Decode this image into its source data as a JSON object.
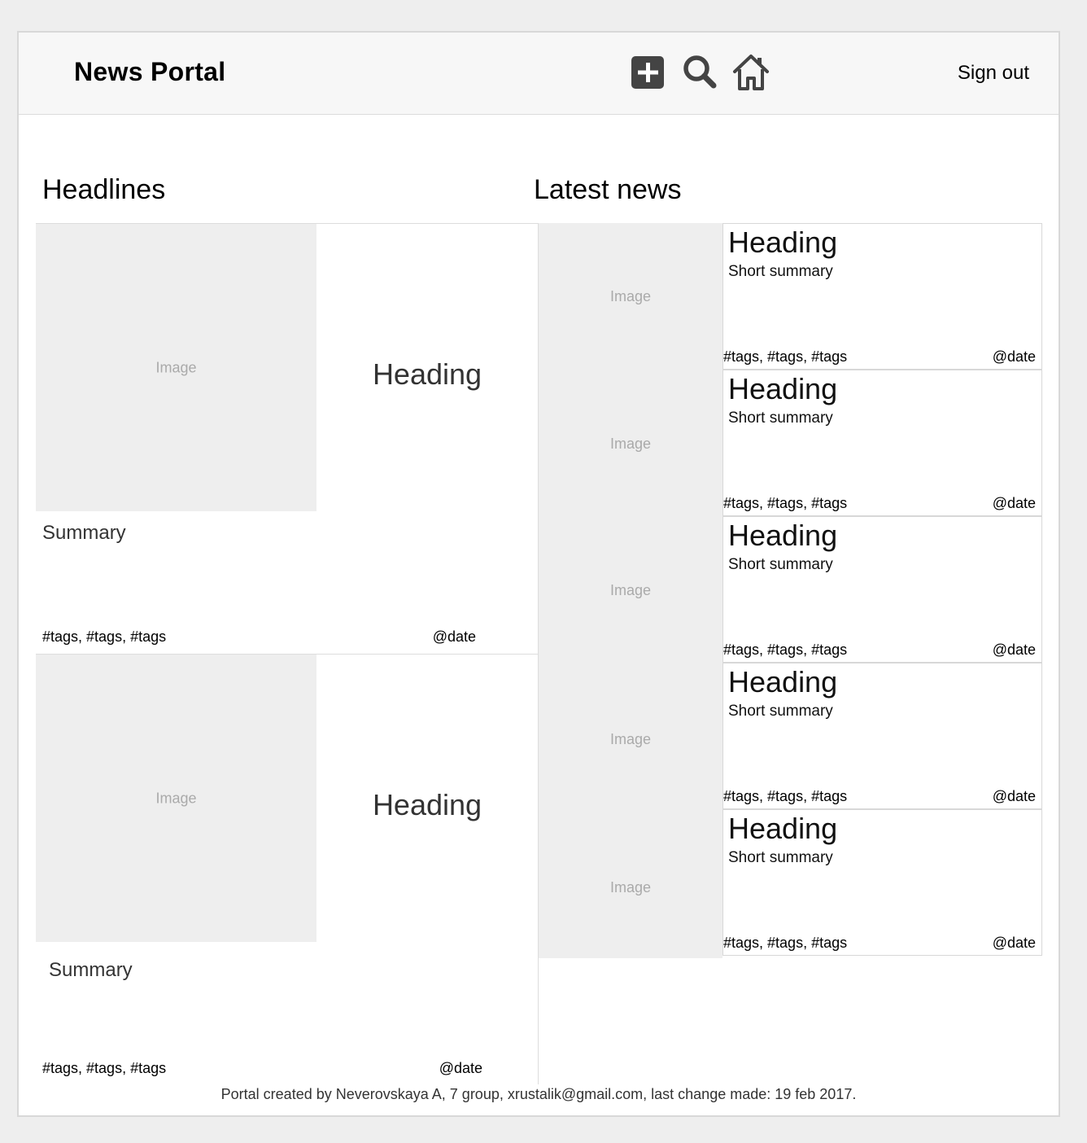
{
  "header": {
    "title": "News Portal",
    "sign_out_label": "Sign out",
    "icons": [
      "add-icon",
      "search-icon",
      "home-icon"
    ]
  },
  "sections": {
    "headlines_title": "Headlines",
    "latest_title": "Latest news"
  },
  "headlines": [
    {
      "image_label": "Image",
      "heading": "Heading",
      "summary": "Summary",
      "tags": "#tags, #tags, #tags",
      "date": "@date"
    },
    {
      "image_label": "Image",
      "heading": "Heading",
      "summary": "Summary",
      "tags": "#tags, #tags, #tags",
      "date": "@date"
    }
  ],
  "latest": {
    "image_labels": [
      "Image",
      "Image",
      "Image",
      "Image",
      "Image"
    ],
    "items": [
      {
        "heading": "Heading",
        "summary": "Short summary",
        "tags": "#tags, #tags, #tags",
        "date": "@date"
      },
      {
        "heading": "Heading",
        "summary": "Short summary",
        "tags": "#tags, #tags, #tags",
        "date": "@date"
      },
      {
        "heading": "Heading",
        "summary": "Short summary",
        "tags": "#tags, #tags, #tags",
        "date": "@date"
      },
      {
        "heading": "Heading",
        "summary": "Short summary",
        "tags": "#tags, #tags, #tags",
        "date": "@date"
      },
      {
        "heading": "Heading",
        "summary": "Short summary",
        "tags": "#tags, #tags, #tags",
        "date": "@date"
      }
    ]
  },
  "footer": {
    "text": "Portal created by Neverovskaya A, 7 group, xrustalik@gmail.com, last change made: 19 feb 2017."
  },
  "colors": {
    "icon": "#444444",
    "placeholder": "#eeeeee",
    "header_bg": "#f7f7f7"
  }
}
